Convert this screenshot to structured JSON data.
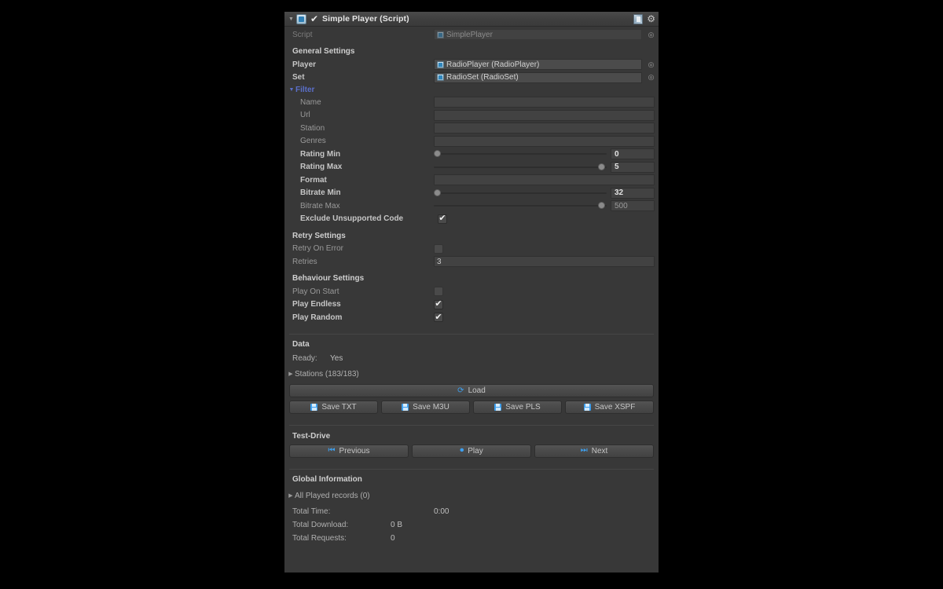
{
  "header": {
    "foldout": "▼",
    "checkbox": "✔",
    "title": "Simple Player (Script)",
    "help_icon": "help-icon",
    "gear_icon": "⚙"
  },
  "script_row": {
    "label": "Script",
    "value": "SimplePlayer"
  },
  "general": {
    "title": "General Settings",
    "player": {
      "label": "Player",
      "value": "RadioPlayer (RadioPlayer)"
    },
    "set": {
      "label": "Set",
      "value": "RadioSet (RadioSet)"
    }
  },
  "filter": {
    "foldout": "▼",
    "title": "Filter",
    "name": {
      "label": "Name",
      "value": ""
    },
    "url": {
      "label": "Url",
      "value": ""
    },
    "station": {
      "label": "Station",
      "value": ""
    },
    "genres": {
      "label": "Genres",
      "value": ""
    },
    "rating_min": {
      "label": "Rating Min",
      "value": "0",
      "knob_pct": 0
    },
    "rating_max": {
      "label": "Rating Max",
      "value": "5",
      "knob_pct": 100
    },
    "format": {
      "label": "Format",
      "value": ""
    },
    "bitrate_min": {
      "label": "Bitrate Min",
      "value": "32",
      "knob_pct": 0
    },
    "bitrate_max": {
      "label": "Bitrate Max",
      "value": "500",
      "knob_pct": 100
    },
    "exclude": {
      "label": "Exclude Unsupported Code",
      "checked": "✔"
    }
  },
  "retry": {
    "title": "Retry Settings",
    "retry_on_error": {
      "label": "Retry On Error",
      "checked": ""
    },
    "retries": {
      "label": "Retries",
      "value": "3"
    }
  },
  "behaviour": {
    "title": "Behaviour Settings",
    "play_on_start": {
      "label": "Play On Start",
      "checked": ""
    },
    "play_endless": {
      "label": "Play Endless",
      "checked": "✔"
    },
    "play_random": {
      "label": "Play Random",
      "checked": "✔"
    }
  },
  "data": {
    "title": "Data",
    "ready_label": "Ready:",
    "ready_value": "Yes",
    "stations_arrow": "▶",
    "stations_label": "Stations (183/183)",
    "load_button": "Load",
    "load_icon": "⟳",
    "save_buttons": [
      {
        "label": "Save TXT"
      },
      {
        "label": "Save M3U"
      },
      {
        "label": "Save PLS"
      },
      {
        "label": "Save XSPF"
      }
    ]
  },
  "test_drive": {
    "title": "Test-Drive",
    "previous": {
      "label": "Previous",
      "icon": "⏮"
    },
    "play": {
      "label": "Play",
      "icon": "⏺"
    },
    "next": {
      "label": "Next",
      "icon": "⏭"
    }
  },
  "global_info": {
    "title": "Global Information",
    "all_played_arrow": "▶",
    "all_played_label": "All Played records (0)",
    "total_time": {
      "label": "Total Time:",
      "value": "0:00"
    },
    "total_download": {
      "label": "Total Download:",
      "value": "0 B"
    },
    "total_requests": {
      "label": "Total Requests:",
      "value": "0"
    }
  },
  "colors": {
    "panel_bg": "#383838",
    "accent_blue": "#3ea0ef",
    "foldout_blue": "#5b6fc9"
  }
}
